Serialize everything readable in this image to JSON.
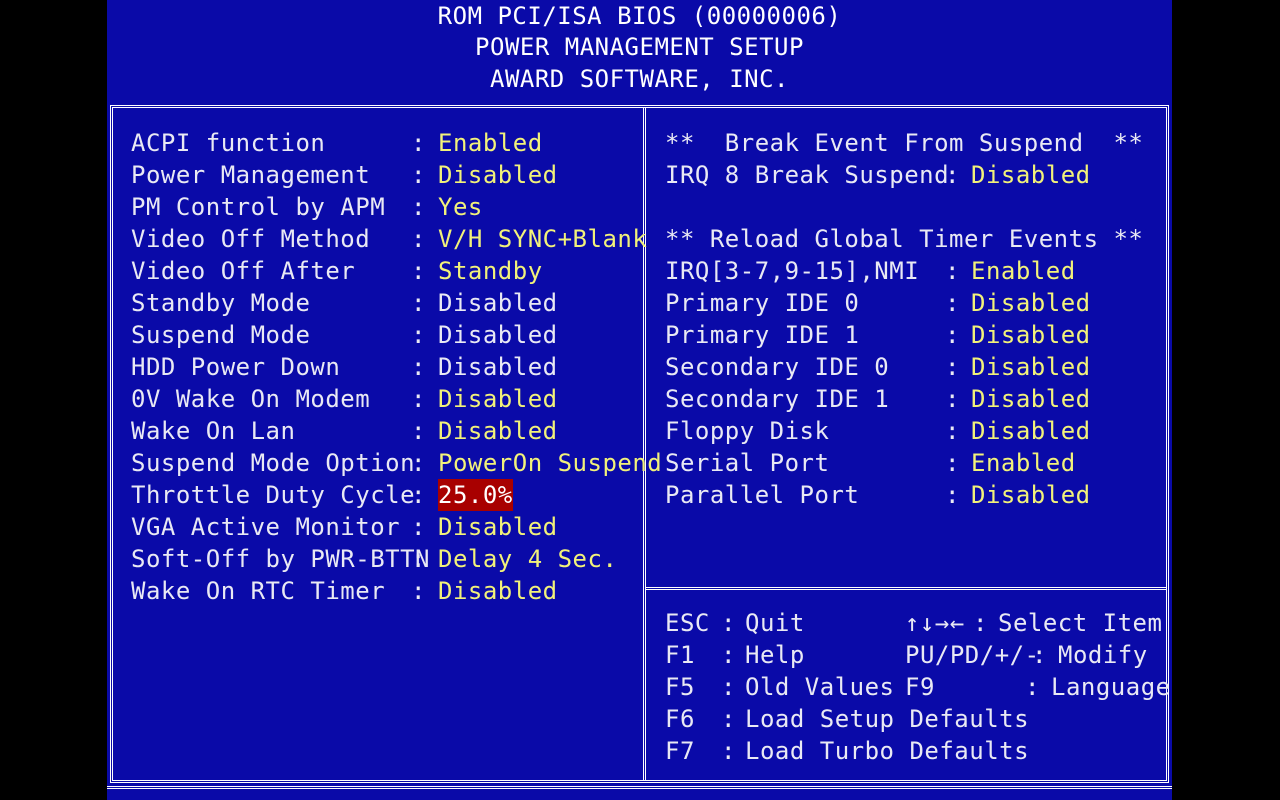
{
  "header": {
    "line1": "ROM PCI/ISA BIOS (00000006)",
    "line2": "POWER MANAGEMENT SETUP",
    "line3": "AWARD SOFTWARE, INC."
  },
  "left_settings": [
    {
      "label": "ACPI function",
      "value": "Enabled",
      "state": "changeable"
    },
    {
      "label": "Power Management",
      "value": "Disabled",
      "state": "changeable"
    },
    {
      "label": "PM Control by APM",
      "value": "Yes",
      "state": "changeable"
    },
    {
      "label": "Video Off Method",
      "value": "V/H SYNC+Blank",
      "state": "changeable"
    },
    {
      "label": "Video Off After",
      "value": "Standby",
      "state": "changeable"
    },
    {
      "label": "Standby Mode",
      "value": "Disabled",
      "state": "locked"
    },
    {
      "label": "Suspend Mode",
      "value": "Disabled",
      "state": "locked"
    },
    {
      "label": "HDD Power Down",
      "value": "Disabled",
      "state": "locked"
    },
    {
      "label": "0V Wake On Modem",
      "value": "Disabled",
      "state": "changeable"
    },
    {
      "label": "Wake On Lan",
      "value": "Disabled",
      "state": "changeable"
    },
    {
      "label": "Suspend Mode Option",
      "value": "PowerOn Suspend",
      "state": "changeable"
    },
    {
      "label": "Throttle Duty Cycle",
      "value": "25.0%",
      "state": "selected"
    },
    {
      "label": "VGA Active Monitor",
      "value": "Disabled",
      "state": "changeable"
    },
    {
      "label": "Soft-Off by PWR-BTTN",
      "value": "Delay 4 Sec.",
      "state": "changeable"
    },
    {
      "label": "Wake On RTC Timer",
      "value": "Disabled",
      "state": "changeable"
    }
  ],
  "right_panel": {
    "break_heading": "**  Break Event From Suspend  **",
    "break_settings": [
      {
        "label": "IRQ 8 Break Suspend",
        "value": "Disabled"
      }
    ],
    "reload_heading": "** Reload Global Timer Events **",
    "reload_settings": [
      {
        "label": "IRQ[3-7,9-15],NMI",
        "value": "Enabled"
      },
      {
        "label": "Primary IDE 0",
        "value": "Disabled"
      },
      {
        "label": "Primary IDE 1",
        "value": "Disabled"
      },
      {
        "label": "Secondary IDE 0",
        "value": "Disabled"
      },
      {
        "label": "Secondary IDE 1",
        "value": "Disabled"
      },
      {
        "label": "Floppy Disk",
        "value": "Disabled"
      },
      {
        "label": "Serial Port",
        "value": "Enabled"
      },
      {
        "label": "Parallel Port",
        "value": "Disabled"
      }
    ]
  },
  "help": {
    "lines": [
      {
        "key": "ESC",
        "action": "Quit",
        "key2": "↑↓→←",
        "action2": "Select Item"
      },
      {
        "key": "F1",
        "action": "Help",
        "key2": "PU/PD/+/-",
        "action2": "Modify"
      },
      {
        "key": "F5",
        "action": "Old Values",
        "key2": "F9",
        "action2": "Language"
      },
      {
        "key": "F6",
        "action": "Load Setup Defaults",
        "key2": "",
        "action2": ""
      },
      {
        "key": "F7",
        "action": "Load Turbo Defaults",
        "key2": "",
        "action2": ""
      }
    ]
  },
  "colors": {
    "background": "#0a0aa8",
    "value_text": "#f2f27a",
    "label_text": "#e9e9f4",
    "selection": "#a80000"
  }
}
